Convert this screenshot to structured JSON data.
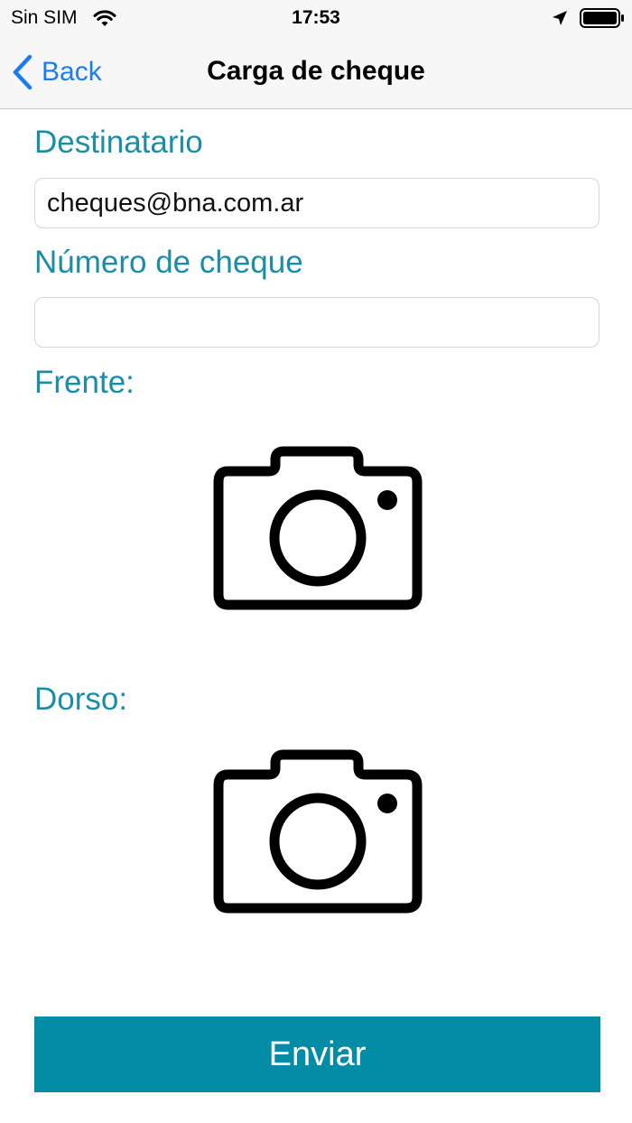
{
  "status_bar": {
    "carrier": "Sin SIM",
    "time": "17:53",
    "icons": [
      "wifi-icon",
      "location-icon",
      "battery-icon"
    ]
  },
  "nav": {
    "back_label": "Back",
    "title": "Carga de cheque",
    "back_icon": "chevron-left-icon"
  },
  "form": {
    "recipient_label": "Destinatario",
    "recipient_value": "cheques@bna.com.ar",
    "check_number_label": "Número de cheque",
    "check_number_value": "",
    "front_label": "Frente:",
    "front_icon": "camera-icon",
    "back_side_label": "Dorso:",
    "back_side_icon": "camera-icon",
    "submit_label": "Enviar"
  },
  "colors": {
    "accent": "#038ca6",
    "label": "#1a8ea6",
    "link": "#1a7cf2",
    "bar_background": "#f7f7f7"
  }
}
